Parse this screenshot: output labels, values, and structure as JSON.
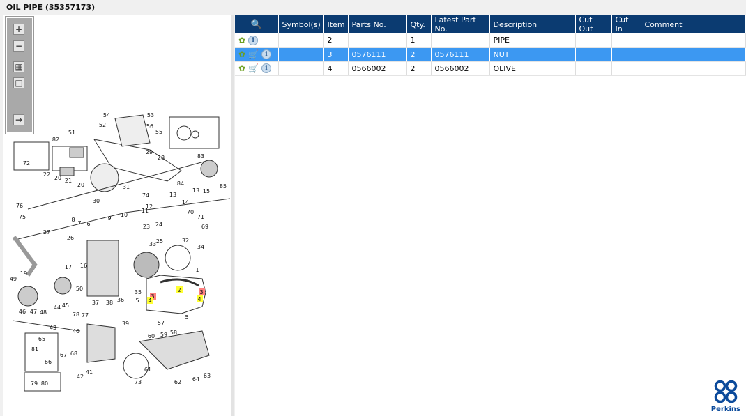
{
  "title": "OIL PIPE (35357173)",
  "toolbar": {
    "zoom_in": "+",
    "zoom_out": "−"
  },
  "table": {
    "headers": [
      "Symbol(s)",
      "Item",
      "Parts No.",
      "Qty.",
      "Latest Part No.",
      "Description",
      "Cut Out",
      "Cut In",
      "Comment"
    ],
    "rows": [
      {
        "cart": false,
        "symbols": "",
        "item": "2",
        "parts_no": "",
        "qty": "1",
        "latest": "",
        "description": "PIPE",
        "cut_out": "",
        "cut_in": "",
        "comment": "",
        "selected": false
      },
      {
        "cart": true,
        "symbols": "",
        "item": "3",
        "parts_no": "0576111",
        "qty": "2",
        "latest": "0576111",
        "description": "NUT",
        "cut_out": "",
        "cut_in": "",
        "comment": "",
        "selected": true
      },
      {
        "cart": true,
        "symbols": "",
        "item": "4",
        "parts_no": "0566002",
        "qty": "2",
        "latest": "0566002",
        "description": "OLIVE",
        "cut_out": "",
        "cut_in": "",
        "comment": "",
        "selected": false
      }
    ]
  },
  "diagram": {
    "callouts": [
      "54",
      "53",
      "51",
      "52",
      "56",
      "55",
      "83",
      "72",
      "82",
      "29",
      "28",
      "22",
      "20",
      "21",
      "20",
      "31",
      "85",
      "84",
      "76",
      "30",
      "74",
      "13",
      "13",
      "15",
      "14",
      "12",
      "75",
      "11",
      "10",
      "70",
      "71",
      "8",
      "9",
      "7",
      "6",
      "23",
      "24",
      "69",
      "27",
      "26",
      "25",
      "32",
      "33",
      "34",
      "17",
      "16",
      "1",
      "19",
      "49",
      "50",
      "35",
      "2",
      "3",
      "3",
      "4",
      "4",
      "36",
      "46",
      "47",
      "48",
      "44",
      "45",
      "37",
      "38",
      "5",
      "5",
      "78",
      "77",
      "39",
      "57",
      "43",
      "40",
      "59",
      "58",
      "60",
      "65",
      "81",
      "67",
      "68",
      "66",
      "61",
      "42",
      "41",
      "73",
      "62",
      "64",
      "63",
      "79",
      "80"
    ],
    "highlight": {
      "2": "#ffff33",
      "3": "#ff8080",
      "4": "#ffff33"
    }
  },
  "logo": {
    "name": "Perkins"
  }
}
